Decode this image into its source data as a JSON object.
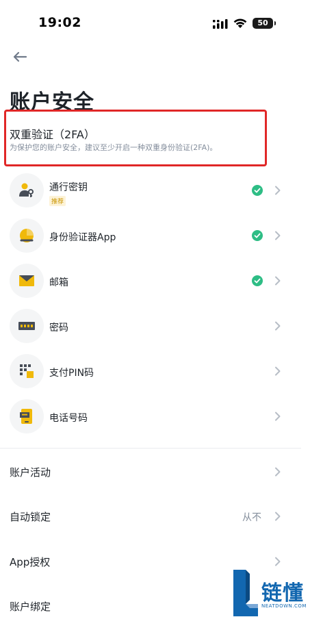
{
  "status_bar": {
    "time": "19:02",
    "battery": "50"
  },
  "page": {
    "title": "账户安全"
  },
  "twofa": {
    "title": "双重验证（2FA）",
    "description": "为保护您的账户安全，建议至少开启一种双重身份验证(2FA)。"
  },
  "methods": [
    {
      "label": "通行密钥",
      "tag": "推荐",
      "enabled": true,
      "icon": "passkey-icon"
    },
    {
      "label": "身份验证器App",
      "enabled": true,
      "icon": "authenticator-icon"
    },
    {
      "label": "邮箱",
      "enabled": true,
      "icon": "email-icon"
    },
    {
      "label": "密码",
      "enabled": false,
      "icon": "password-icon"
    },
    {
      "label": "支付PIN码",
      "enabled": false,
      "icon": "pin-icon"
    },
    {
      "label": "电话号码",
      "enabled": false,
      "icon": "phone-icon"
    }
  ],
  "settings": [
    {
      "label": "账户活动"
    },
    {
      "label": "自动锁定",
      "value": "从不"
    },
    {
      "label": "App授权"
    },
    {
      "label": "账户绑定"
    }
  ],
  "watermark": {
    "text": "链懂",
    "sub": "NEATDOWN.COM"
  },
  "colors": {
    "accent": "#f0b90b",
    "check": "#2ebd85",
    "alert_border": "#e02727",
    "watermark": "#1267b0"
  }
}
